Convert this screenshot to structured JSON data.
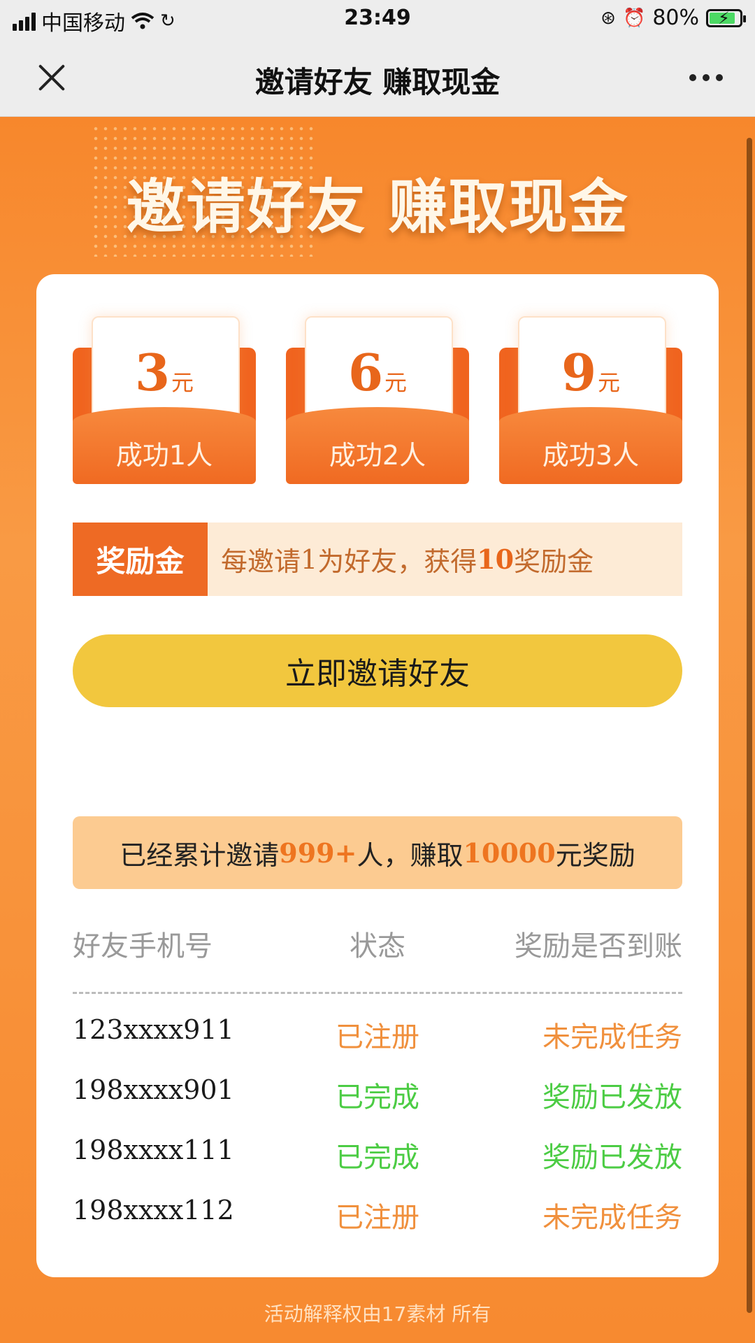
{
  "status_bar": {
    "carrier": "中国移动",
    "time": "23:49",
    "battery": "80%"
  },
  "nav": {
    "title": "邀请好友 赚取现金"
  },
  "hero": {
    "title": "邀请好友 赚取现金"
  },
  "tiers": [
    {
      "amount": "3",
      "unit": "元",
      "label": "成功1人"
    },
    {
      "amount": "6",
      "unit": "元",
      "label": "成功2人"
    },
    {
      "amount": "9",
      "unit": "元",
      "label": "成功3人"
    }
  ],
  "reward": {
    "tag": "奖励金",
    "text_prefix": "每邀请",
    "count": "1",
    "text_mid": "为好友，获得",
    "amount": "10",
    "text_suffix": "奖励金"
  },
  "invite_button": "立即邀请好友",
  "summary": {
    "prefix": "已经累计邀请",
    "count": "999+",
    "mid": "人，赚取",
    "amount": "10000",
    "suffix": "元奖励"
  },
  "table": {
    "headers": [
      "好友手机号",
      "状态",
      "奖励是否到账"
    ],
    "rows": [
      {
        "phone": "123xxxx911",
        "status": "已注册",
        "reward": "未完成任务"
      },
      {
        "phone": "198xxxx901",
        "status": "已完成",
        "reward": "奖励已发放"
      },
      {
        "phone": "198xxxx111",
        "status": "已完成",
        "reward": "奖励已发放"
      },
      {
        "phone": "198xxxx112",
        "status": "已注册",
        "reward": "未完成任务"
      }
    ]
  },
  "footer": "活动解释权由17素材 所有",
  "colors": {
    "primary_orange": "#f7892f",
    "accent_yellow": "#f2c73e",
    "status_pending": "#f0903d",
    "status_done": "#4ccc44"
  }
}
